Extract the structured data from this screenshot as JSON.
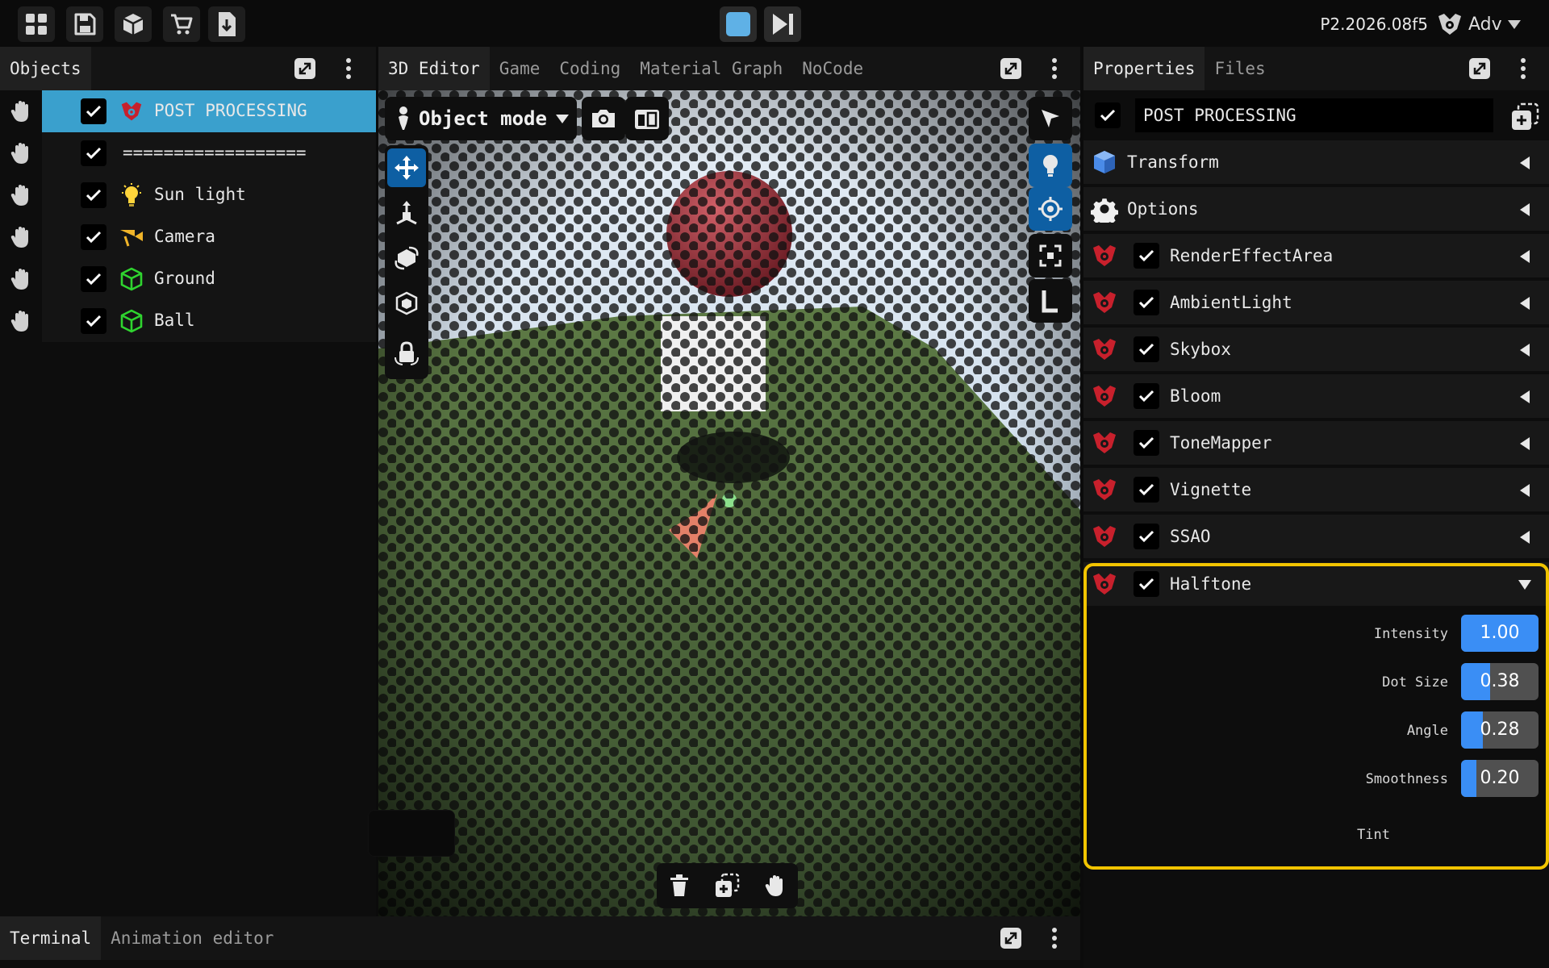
{
  "topbar": {
    "icons": [
      "grid-icon",
      "save-icon",
      "cube-icon",
      "cart-icon",
      "download-file-icon"
    ],
    "version": "P2.2026.08f5",
    "user": "Adv",
    "play_controls": [
      "stop-icon",
      "step-forward-icon"
    ]
  },
  "objects_panel": {
    "tab": "Objects",
    "items": [
      {
        "name": "POST PROCESSING",
        "checked": true,
        "icon": "postprocess-icon",
        "selected": true
      },
      {
        "name": "==================",
        "checked": true,
        "icon": "",
        "selected": false
      },
      {
        "name": "Sun light",
        "checked": true,
        "icon": "bulb-icon",
        "selected": false
      },
      {
        "name": "Camera",
        "checked": true,
        "icon": "camera-icon",
        "selected": false
      },
      {
        "name": "Ground",
        "checked": true,
        "icon": "mesh-icon",
        "selected": false
      },
      {
        "name": "Ball",
        "checked": true,
        "icon": "mesh-icon",
        "selected": false
      }
    ]
  },
  "viewport_panel": {
    "tabs": [
      "3D Editor",
      "Game",
      "Coding",
      "Material Graph",
      "NoCode"
    ],
    "active_tab": "3D Editor",
    "mode": "Object mode"
  },
  "bottom_panel": {
    "tabs": [
      "Terminal",
      "Animation editor"
    ],
    "active_tab": "Terminal"
  },
  "properties_panel": {
    "tabs": [
      "Properties",
      "Files"
    ],
    "active_tab": "Properties",
    "object_name": "POST PROCESSING",
    "sections": [
      {
        "label": "Transform",
        "icon": "cube-icon",
        "has_checkbox": false
      },
      {
        "label": "Options",
        "icon": "gear-icon",
        "has_checkbox": false
      },
      {
        "label": "RenderEffectArea",
        "icon": "postprocess-icon",
        "has_checkbox": true
      },
      {
        "label": "AmbientLight",
        "icon": "postprocess-icon",
        "has_checkbox": true
      },
      {
        "label": "Skybox",
        "icon": "postprocess-icon",
        "has_checkbox": true
      },
      {
        "label": "Bloom",
        "icon": "postprocess-icon",
        "has_checkbox": true
      },
      {
        "label": "ToneMapper",
        "icon": "postprocess-icon",
        "has_checkbox": true
      },
      {
        "label": "Vignette",
        "icon": "postprocess-icon",
        "has_checkbox": true
      },
      {
        "label": "SSAO",
        "icon": "postprocess-icon",
        "has_checkbox": true
      }
    ],
    "halftone": {
      "label": "Halftone",
      "expanded": true,
      "params": [
        {
          "label": "Intensity",
          "value": "1.00",
          "fill": 1.0
        },
        {
          "label": "Dot Size",
          "value": "0.38",
          "fill": 0.38
        },
        {
          "label": "Angle",
          "value": "0.28",
          "fill": 0.28
        },
        {
          "label": "Smoothness",
          "value": "0.20",
          "fill": 0.2
        }
      ],
      "tint_label": "Tint",
      "tint_color": "#0a0a0a"
    }
  },
  "colors": {
    "selected_row": "#3aa0cd",
    "active_tool": "#0e5fa3",
    "slider_fill": "#3a8ef5",
    "highlight_border": "#f2c400",
    "postprocess_icon": "#c8202c",
    "mesh_icon": "#2fd42f"
  }
}
